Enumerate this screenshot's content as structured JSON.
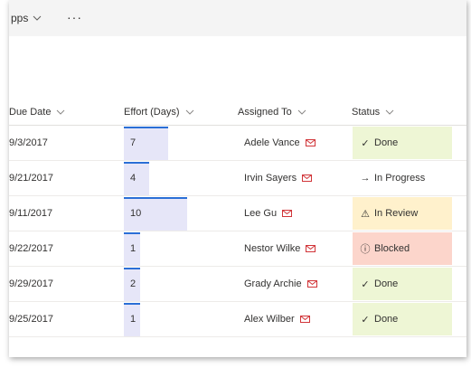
{
  "toolbar": {
    "apps_label": "pps",
    "more_label": "···"
  },
  "columns": {
    "due_date": "Due Date",
    "effort": "Effort (Days)",
    "assigned_to": "Assigned To",
    "status": "Status"
  },
  "effort_max": 10,
  "colors": {
    "done": "#eef6d5",
    "in_review": "#fff1cc",
    "blocked": "#fcd5cb",
    "in_progress": "#ffffff",
    "effort_bar": "#e6e6f8",
    "effort_accent": "#2b6fd6",
    "mail": "#d13438"
  },
  "rows": [
    {
      "due": "9/3/2017",
      "effort": 7,
      "effort_label": "7",
      "assignee": "Adele Vance",
      "status": "Done",
      "status_key": "done",
      "status_icon": "check-icon"
    },
    {
      "due": "9/21/2017",
      "effort": 4,
      "effort_label": "4",
      "assignee": "Irvin Sayers",
      "status": "In Progress",
      "status_key": "in_progress",
      "status_icon": "arrow-right-icon"
    },
    {
      "due": "9/11/2017",
      "effort": 10,
      "effort_label": "10",
      "assignee": "Lee Gu",
      "status": "In Review",
      "status_key": "in_review",
      "status_icon": "warning-icon"
    },
    {
      "due": "9/22/2017",
      "effort": 1,
      "effort_label": "1",
      "assignee": "Nestor Wilke",
      "status": "Blocked",
      "status_key": "blocked",
      "status_icon": "info-icon"
    },
    {
      "due": "9/29/2017",
      "effort": 2,
      "effort_label": "2",
      "assignee": "Grady Archie",
      "status": "Done",
      "status_key": "done",
      "status_icon": "check-icon"
    },
    {
      "due": "9/25/2017",
      "effort": 1,
      "effort_label": "1",
      "assignee": "Alex Wilber",
      "status": "Done",
      "status_key": "done",
      "status_icon": "check-icon"
    }
  ]
}
